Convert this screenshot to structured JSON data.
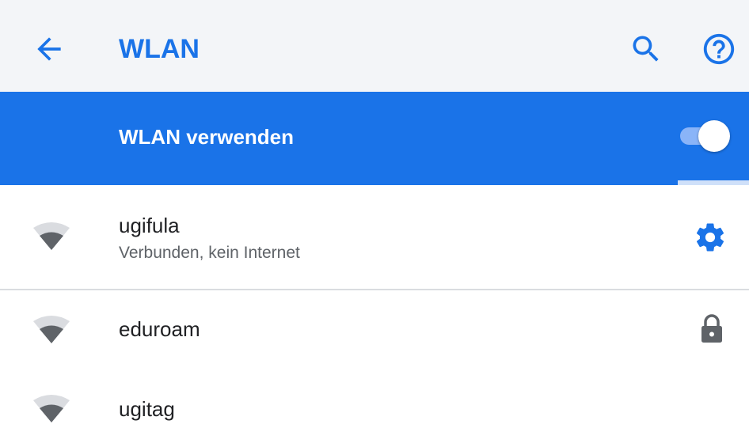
{
  "header": {
    "title": "WLAN",
    "back_icon": "arrow-back-icon",
    "search_icon": "search-icon",
    "help_icon": "help-icon"
  },
  "master_switch": {
    "label": "WLAN verwenden",
    "state": "on"
  },
  "scan_progress": 0.905,
  "networks": [
    {
      "name": "ugifula",
      "status": "Verbunden, kein Internet",
      "action_icon": "gear-icon",
      "signal_icon": "wifi-signal-icon"
    },
    {
      "name": "eduroam",
      "status": "",
      "action_icon": "lock-icon",
      "signal_icon": "wifi-signal-icon"
    },
    {
      "name": "ugitag",
      "status": "",
      "action_icon": "",
      "signal_icon": "wifi-signal-icon"
    }
  ],
  "colors": {
    "accent": "#1a73e8",
    "appbar_bg": "#f3f5f8",
    "icon_gray": "#5f6368",
    "divider": "#dadce0"
  }
}
